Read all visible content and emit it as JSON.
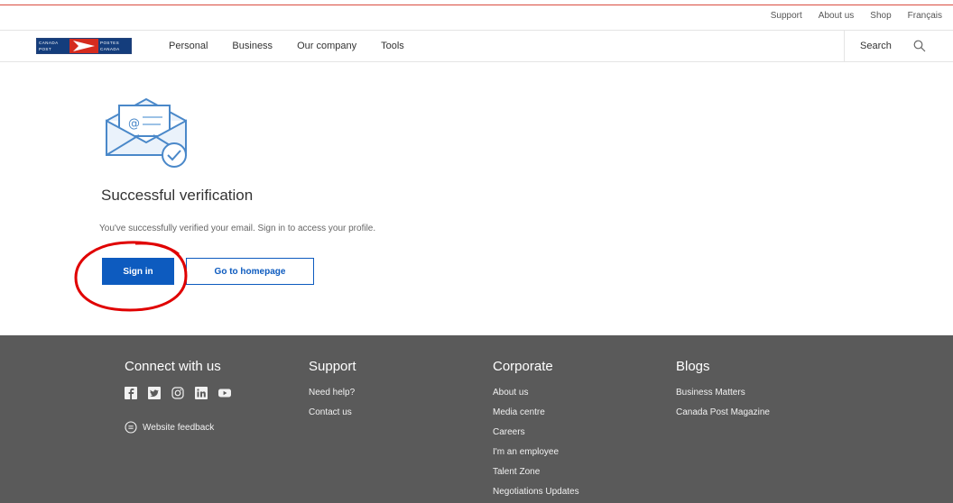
{
  "utility_nav": {
    "items": [
      "Support",
      "About us",
      "Shop",
      "Français"
    ]
  },
  "brand": {
    "logo_text_en": "CANADA POST",
    "logo_text_fr": "POSTES CANADA",
    "colors": {
      "blue": "#143d7c",
      "red": "#d52b1e"
    }
  },
  "main_nav": {
    "items": [
      "Personal",
      "Business",
      "Our company",
      "Tools"
    ],
    "search_label": "Search",
    "search_icon": "magnifier"
  },
  "content": {
    "illustration": "envelope-with-checkmark",
    "title": "Successful verification",
    "description": "You've successfully verified your email. Sign in to access your profile.",
    "sign_in_label": "Sign in",
    "homepage_label": "Go to homepage",
    "annotation_color": "#e00000"
  },
  "footer": {
    "connect": {
      "heading": "Connect with us",
      "social_icons": [
        "facebook-icon",
        "twitter-icon",
        "instagram-icon",
        "linkedin-icon",
        "youtube-icon"
      ],
      "feedback_label": "Website feedback"
    },
    "support": {
      "heading": "Support",
      "links": [
        "Need help?",
        "Contact us"
      ]
    },
    "corporate": {
      "heading": "Corporate",
      "links": [
        "About us",
        "Media centre",
        "Careers",
        "I'm an employee",
        "Talent Zone",
        "Negotiations Updates"
      ]
    },
    "blogs": {
      "heading": "Blogs",
      "links": [
        "Business Matters",
        "Canada Post Magazine"
      ]
    }
  }
}
